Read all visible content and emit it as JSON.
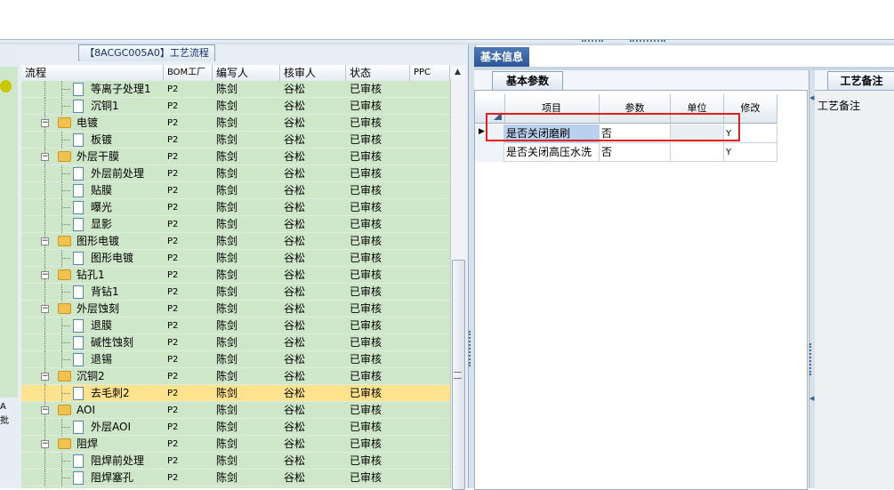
{
  "tree_panel": {
    "tab_label": "【8ACGC005A0】工艺流程",
    "columns": [
      "流程",
      "BOM工厂",
      "编写人",
      "核审人",
      "状态",
      "PPC"
    ],
    "rows": [
      {
        "name": "等离子处理1",
        "level": 2,
        "kind": "doc",
        "bom": "P2",
        "writer": "陈剑",
        "reviewer": "谷松",
        "status": "已审核"
      },
      {
        "name": "沉铜1",
        "level": 2,
        "kind": "doc",
        "bom": "P2",
        "writer": "陈剑",
        "reviewer": "谷松",
        "status": "已审核"
      },
      {
        "name": "电镀",
        "level": 1,
        "kind": "folder",
        "bom": "P2",
        "writer": "陈剑",
        "reviewer": "谷松",
        "status": "已审核"
      },
      {
        "name": "板镀",
        "level": 2,
        "kind": "doc",
        "bom": "P2",
        "writer": "陈剑",
        "reviewer": "谷松",
        "status": "已审核"
      },
      {
        "name": "外层干膜",
        "level": 1,
        "kind": "folder",
        "bom": "P2",
        "writer": "陈剑",
        "reviewer": "谷松",
        "status": "已审核"
      },
      {
        "name": "外层前处理",
        "level": 2,
        "kind": "doc",
        "bom": "P2",
        "writer": "陈剑",
        "reviewer": "谷松",
        "status": "已审核"
      },
      {
        "name": "贴膜",
        "level": 2,
        "kind": "doc",
        "bom": "P2",
        "writer": "陈剑",
        "reviewer": "谷松",
        "status": "已审核"
      },
      {
        "name": "曝光",
        "level": 2,
        "kind": "doc",
        "bom": "P2",
        "writer": "陈剑",
        "reviewer": "谷松",
        "status": "已审核"
      },
      {
        "name": "显影",
        "level": 2,
        "kind": "doc",
        "bom": "P2",
        "writer": "陈剑",
        "reviewer": "谷松",
        "status": "已审核"
      },
      {
        "name": "图形电镀",
        "level": 1,
        "kind": "folder",
        "bom": "P2",
        "writer": "陈剑",
        "reviewer": "谷松",
        "status": "已审核"
      },
      {
        "name": "图形电镀",
        "level": 2,
        "kind": "doc",
        "bom": "P2",
        "writer": "陈剑",
        "reviewer": "谷松",
        "status": "已审核"
      },
      {
        "name": "钻孔1",
        "level": 1,
        "kind": "folder",
        "bom": "P2",
        "writer": "陈剑",
        "reviewer": "谷松",
        "status": "已审核"
      },
      {
        "name": "背钻1",
        "level": 2,
        "kind": "doc",
        "bom": "P2",
        "writer": "陈剑",
        "reviewer": "谷松",
        "status": "已审核"
      },
      {
        "name": "外层蚀刻",
        "level": 1,
        "kind": "folder",
        "bom": "P2",
        "writer": "陈剑",
        "reviewer": "谷松",
        "status": "已审核"
      },
      {
        "name": "退膜",
        "level": 2,
        "kind": "doc",
        "bom": "P2",
        "writer": "陈剑",
        "reviewer": "谷松",
        "status": "已审核"
      },
      {
        "name": "碱性蚀刻",
        "level": 2,
        "kind": "doc",
        "bom": "P2",
        "writer": "陈剑",
        "reviewer": "谷松",
        "status": "已审核"
      },
      {
        "name": "退锡",
        "level": 2,
        "kind": "doc",
        "bom": "P2",
        "writer": "陈剑",
        "reviewer": "谷松",
        "status": "已审核"
      },
      {
        "name": "沉铜2",
        "level": 1,
        "kind": "folder",
        "bom": "P2",
        "writer": "陈剑",
        "reviewer": "谷松",
        "status": "已审核"
      },
      {
        "name": "去毛刺2",
        "level": 2,
        "kind": "doc",
        "bom": "P2",
        "writer": "陈剑",
        "reviewer": "谷松",
        "status": "已审核",
        "selected": true
      },
      {
        "name": "AOI",
        "level": 1,
        "kind": "folder",
        "bom": "P2",
        "writer": "陈剑",
        "reviewer": "谷松",
        "status": "已审核"
      },
      {
        "name": "外层AOI",
        "level": 2,
        "kind": "doc",
        "bom": "P2",
        "writer": "陈剑",
        "reviewer": "谷松",
        "status": "已审核"
      },
      {
        "name": "阻焊",
        "level": 1,
        "kind": "folder",
        "bom": "P2",
        "writer": "陈剑",
        "reviewer": "谷松",
        "status": "已审核"
      },
      {
        "name": "阻焊前处理",
        "level": 2,
        "kind": "doc",
        "bom": "P2",
        "writer": "陈剑",
        "reviewer": "谷松",
        "status": "已审核"
      },
      {
        "name": "阻焊塞孔",
        "level": 2,
        "kind": "doc",
        "bom": "P2",
        "writer": "陈剑",
        "reviewer": "谷松",
        "status": "已审核"
      }
    ]
  },
  "left_mini": {
    "label_a": "A",
    "label_2": "批"
  },
  "info_panel": {
    "tab_label": "基本信息",
    "params_tab_label": "基本参数",
    "columns": [
      "项目",
      "参数",
      "单位",
      "修改"
    ],
    "rows": [
      {
        "item": "是否关闭磨刷",
        "param": "否",
        "unit": "",
        "modify": "Y",
        "current": true
      },
      {
        "item": "是否关闭高压水洗",
        "param": "否",
        "unit": "",
        "modify": "Y"
      }
    ]
  },
  "notes_panel": {
    "tab_label": "工艺备注",
    "field_label": "工艺备注"
  },
  "colors": {
    "tree_row_bg": "#cfe7c9",
    "selected_row_bg": "#ffe38c",
    "info_tab_bg": "#2d5696",
    "highlight_box": "#e02020"
  }
}
